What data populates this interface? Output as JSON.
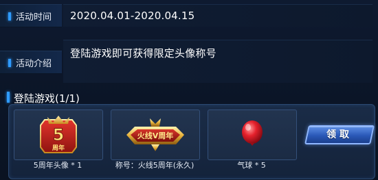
{
  "event_time": {
    "label": "活动时间",
    "value": "2020.04.01-2020.04.15"
  },
  "event_intro": {
    "label": "活动介绍",
    "value": "登陆游戏即可获得限定头像称号"
  },
  "task": {
    "title": "登陆游戏(1/1)"
  },
  "rewards": [
    {
      "icon": "avatar-frame-icon",
      "badge_text": "5",
      "caption": "5周年头像 * 1"
    },
    {
      "icon": "title-badge-icon",
      "badge_text": "火线V周年",
      "caption": "称号：火线5周年(永久)"
    },
    {
      "icon": "balloon-icon",
      "caption": "气球 * 5"
    }
  ],
  "claim_button": {
    "label": "领取"
  },
  "colors": {
    "accent_blue": "#2f9bff",
    "button_blue": "#2a58b7",
    "background": "#0c1628"
  }
}
